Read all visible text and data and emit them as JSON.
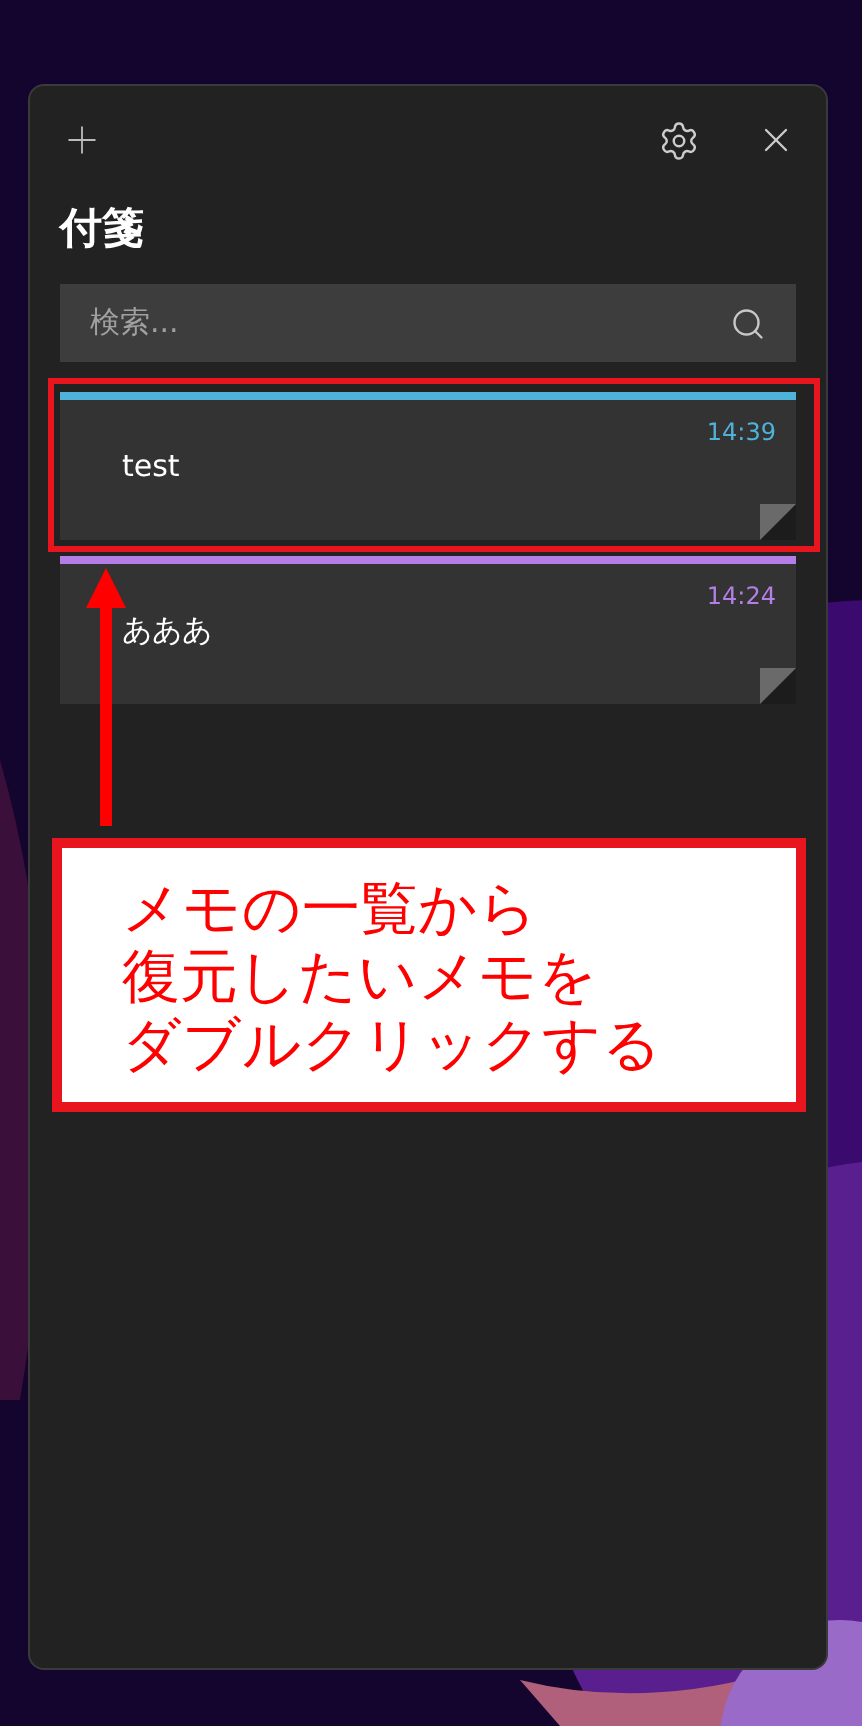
{
  "window": {
    "title": "付箋"
  },
  "search": {
    "placeholder": "検索..."
  },
  "notes": [
    {
      "text": "test",
      "time": "14:39",
      "color": "#4fb3d9"
    },
    {
      "text": "あああ",
      "time": "14:24",
      "color": "#b57ee6"
    }
  ],
  "annotation": {
    "lines": [
      "メモの一覧から",
      "復元したいメモを",
      "ダブルクリックする"
    ]
  }
}
